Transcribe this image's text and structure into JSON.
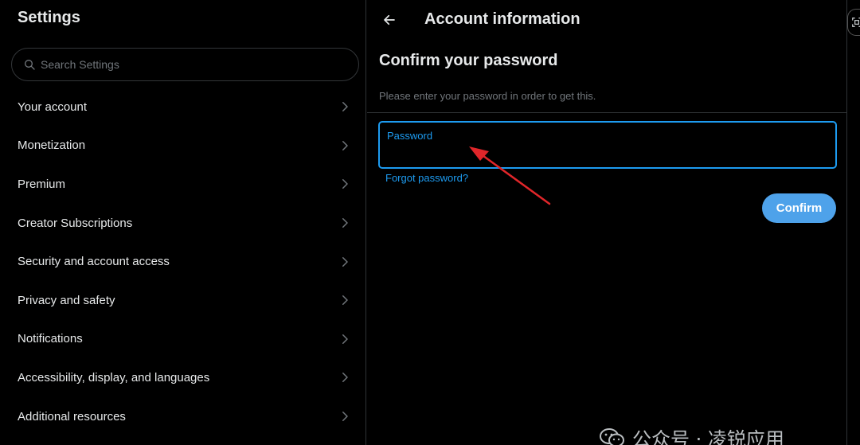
{
  "sidebar": {
    "title": "Settings",
    "search_placeholder": "Search Settings",
    "items": [
      {
        "label": "Your account"
      },
      {
        "label": "Monetization"
      },
      {
        "label": "Premium"
      },
      {
        "label": "Creator Subscriptions"
      },
      {
        "label": "Security and account access"
      },
      {
        "label": "Privacy and safety"
      },
      {
        "label": "Notifications"
      },
      {
        "label": "Accessibility, display, and languages"
      },
      {
        "label": "Additional resources"
      }
    ]
  },
  "main": {
    "header_title": "Account information",
    "section_title": "Confirm your password",
    "description": "Please enter your password in order to get this.",
    "password_label": "Password",
    "password_value": "",
    "forgot_link": "Forgot password?",
    "confirm_button": "Confirm"
  },
  "watermark": {
    "text": "公众号 · 凌锐应用"
  },
  "colors": {
    "background": "#000000",
    "accent": "#1d9bf0",
    "button": "#4ea2ea",
    "annotation_arrow": "#e0262a",
    "muted_text": "#71767b",
    "border": "#2f3336"
  },
  "icons": {
    "search": "search-icon",
    "chevron": "chevron-right-icon",
    "back": "arrow-left-icon",
    "corner": "screenshot-icon",
    "watermark_logo": "wechat-icon"
  }
}
